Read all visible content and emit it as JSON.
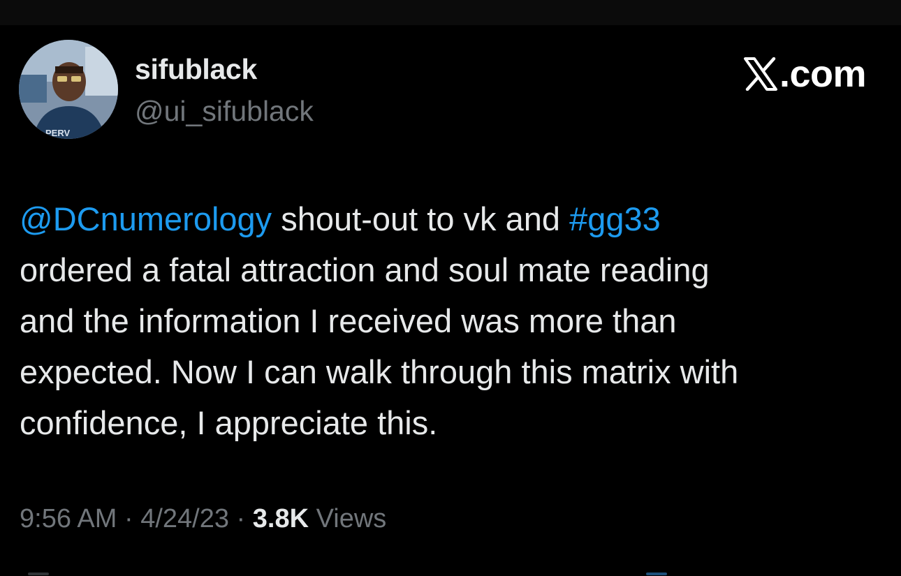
{
  "author": {
    "display_name": "sifublack",
    "handle": "@ui_sifublack",
    "avatar_icon": "profile-photo"
  },
  "brand": {
    "icon": "x-logo-icon",
    "text": ".com"
  },
  "tweet": {
    "mention": "@DCnumerology",
    "line1_mid": " shout-out to vk and ",
    "hashtag": "#gg33",
    "line2": "ordered a fatal attraction and soul mate reading",
    "line3": "and the information I received was more than",
    "line4": "expected. Now I can walk through this matrix with",
    "line5": "confidence, I appreciate this."
  },
  "meta": {
    "time": "9:56 AM",
    "separator": " · ",
    "date": "4/24/23",
    "views_count": "3.8K",
    "views_label": " Views"
  },
  "colors": {
    "background": "#000000",
    "text": "#e7e9ea",
    "secondary": "#71767b",
    "link": "#1d9bf0"
  }
}
